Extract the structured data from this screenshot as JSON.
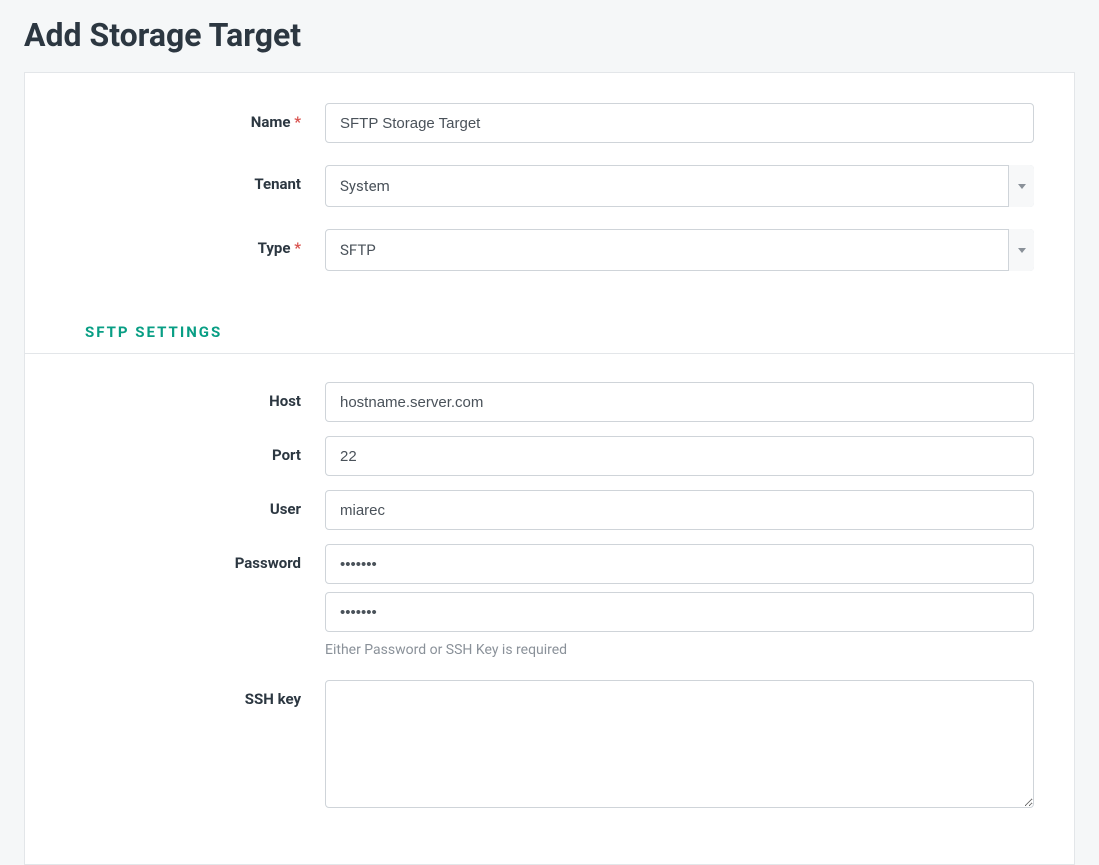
{
  "page": {
    "title": "Add Storage Target"
  },
  "fields": {
    "name": {
      "label": "Name",
      "required": true,
      "value": "SFTP Storage Target"
    },
    "tenant": {
      "label": "Tenant",
      "required": false,
      "selected": "System"
    },
    "type": {
      "label": "Type",
      "required": true,
      "selected": "SFTP"
    }
  },
  "sftp": {
    "section_title": "SFTP SETTINGS",
    "host": {
      "label": "Host",
      "value": "hostname.server.com"
    },
    "port": {
      "label": "Port",
      "value": "22"
    },
    "user": {
      "label": "User",
      "value": "miarec"
    },
    "password": {
      "label": "Password",
      "value1": "•••••••",
      "value2": "•••••••",
      "help": "Either Password or SSH Key is required"
    },
    "ssh_key": {
      "label": "SSH key",
      "value": ""
    }
  }
}
